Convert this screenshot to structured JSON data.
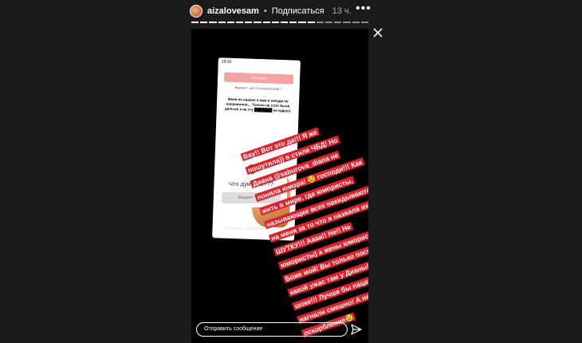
{
  "header": {
    "username": "aizalovesam",
    "separator": "•",
    "follow_label": "Подписаться",
    "time": "13 ч."
  },
  "story": {
    "screenshot": {
      "status_time": "19:02",
      "pink_button_label": "Что нового",
      "question_small": "Вариант: для 2-х разногласий ?",
      "message": "Меня не назвал я вам и никуда не направляли… Только не стоп были дальше а на эту ███████ ни вдругу"
    },
    "question_card": {
      "title": "Что думаете???",
      "input_placeholder": "Введите текст"
    },
    "mini_send_label": "Отправить сообщение",
    "caption": "Вау!! Вот это да!!! Я же пошутила)) в стиле ЧБД! Но Диана @saburova_diana не поняла юмора! 😢 господи!!! Как жить в мире, где юмористы, называющие всех накидываются на меня за то что я назвала их… В ШУТКУ!!! Аааа!! Не!! Не юмористы) а жены юмористов!! О Боже мой! Вы только посмотрите какой ужас там у Дианы! Я в шоке!!! Лучше бы пацаны на меня нагнали смешно! А не эти оскорбления😢",
    "reply_placeholder": "Отправить сообщение"
  },
  "colors": {
    "caption_bg": "#e0202a",
    "page_bg": "#1a1a1a"
  }
}
